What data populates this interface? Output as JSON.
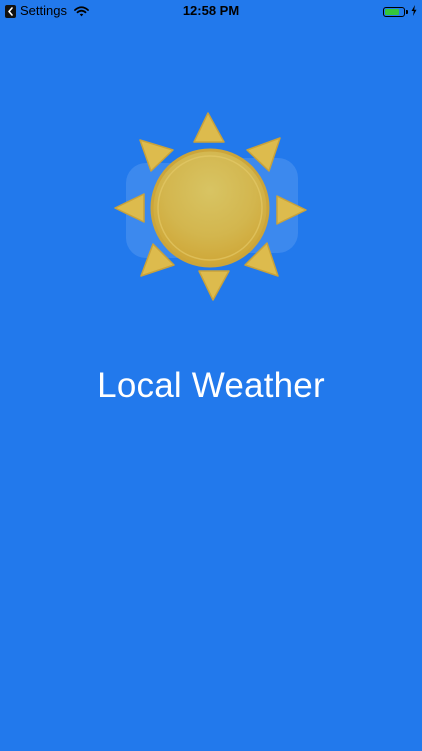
{
  "status_bar": {
    "back_app_label": "Settings",
    "time": "12:58 PM",
    "battery_level": 0.75,
    "battery_color": "#34C739",
    "icons": [
      "back-chevron-icon",
      "wifi-icon",
      "battery-icon",
      "charging-bolt-icon"
    ]
  },
  "splash": {
    "title": "Local Weather",
    "logo_icon": "sun-icon",
    "background_color": "#2279EC",
    "sun_color": "#E2BD45",
    "ray_color": "#DDBB4D"
  }
}
